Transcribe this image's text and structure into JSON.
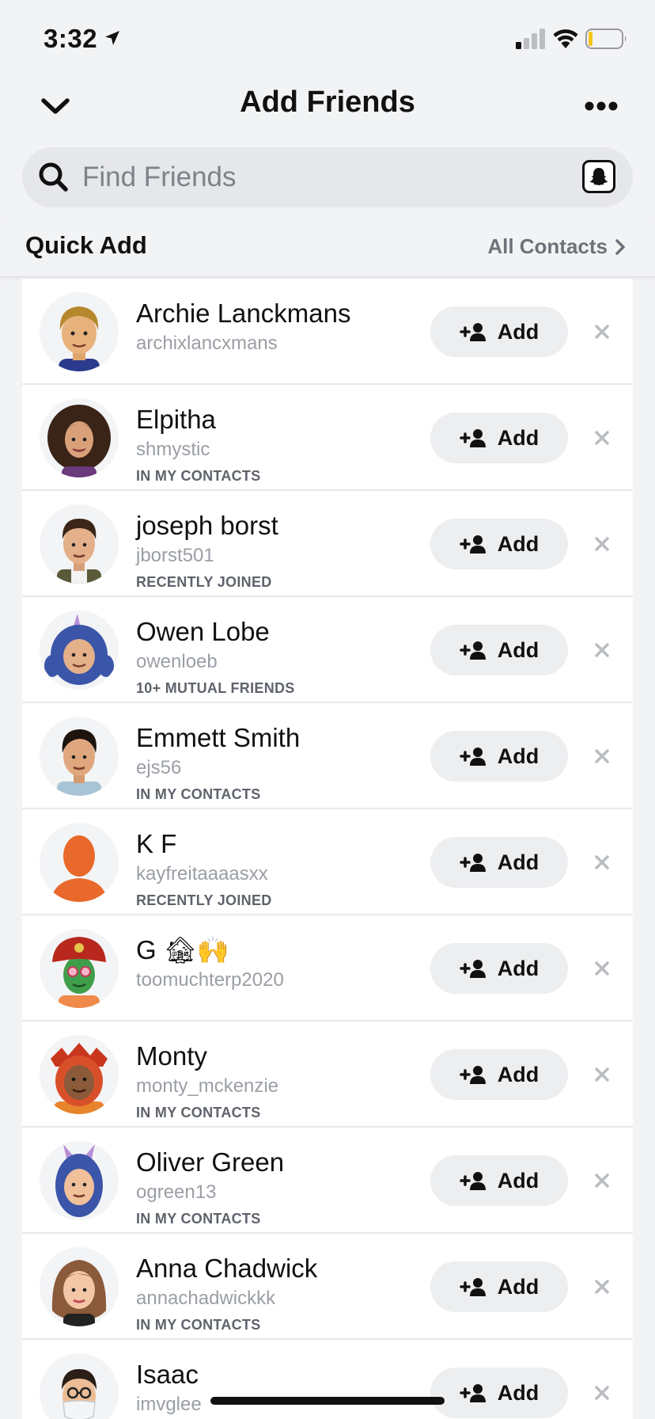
{
  "status_bar": {
    "time": "3:32"
  },
  "header": {
    "title": "Add Friends"
  },
  "search": {
    "placeholder": "Find Friends"
  },
  "section": {
    "title": "Quick Add",
    "link_label": "All Contacts"
  },
  "add_label": "Add",
  "colors": {
    "background": "#f2f3f5",
    "button": "#edeef0",
    "muted_text": "#9a9ea5",
    "reason_text": "#5e636b",
    "kf_avatar": "#e8692b"
  },
  "friends": [
    {
      "name": "Archie Lanckmans",
      "username": "archixlancxmans",
      "reason": "",
      "avatar": "blonde-male-bitmoji"
    },
    {
      "name": "Elpitha",
      "username": "shmystic",
      "reason": "IN MY CONTACTS",
      "avatar": "curly-hair-female-bitmoji"
    },
    {
      "name": "joseph borst",
      "username": "jborst501",
      "reason": "RECENTLY JOINED",
      "avatar": "brown-hair-male-bitmoji"
    },
    {
      "name": "Owen Lobe",
      "username": "owenloeb",
      "reason": "10+ MUTUAL FRIENDS",
      "avatar": "unicorn-hood-bitmoji"
    },
    {
      "name": "Emmett Smith",
      "username": "ejs56",
      "reason": "IN MY CONTACTS",
      "avatar": "dark-hair-male-bitmoji"
    },
    {
      "name": "K F",
      "username": "kayfreitaaaasxx",
      "reason": "RECENTLY JOINED",
      "avatar": "default-silhouette"
    },
    {
      "name": "G 🏚🙌",
      "username": "toomuchterp2020",
      "reason": "",
      "avatar": "green-face-fire-helmet-bitmoji"
    },
    {
      "name": "Monty",
      "username": "monty_mckenzie",
      "reason": "IN MY CONTACTS",
      "avatar": "dragon-hood-bitmoji"
    },
    {
      "name": "Oliver Green",
      "username": "ogreen13",
      "reason": "IN MY CONTACTS",
      "avatar": "unicorn-hood-bitmoji"
    },
    {
      "name": "Anna Chadwick",
      "username": "annachadwickkk",
      "reason": "IN MY CONTACTS",
      "avatar": "long-hair-female-bitmoji"
    },
    {
      "name": "Isaac",
      "username": "imvglee",
      "reason": "",
      "avatar": "glasses-mask-male-bitmoji"
    }
  ]
}
